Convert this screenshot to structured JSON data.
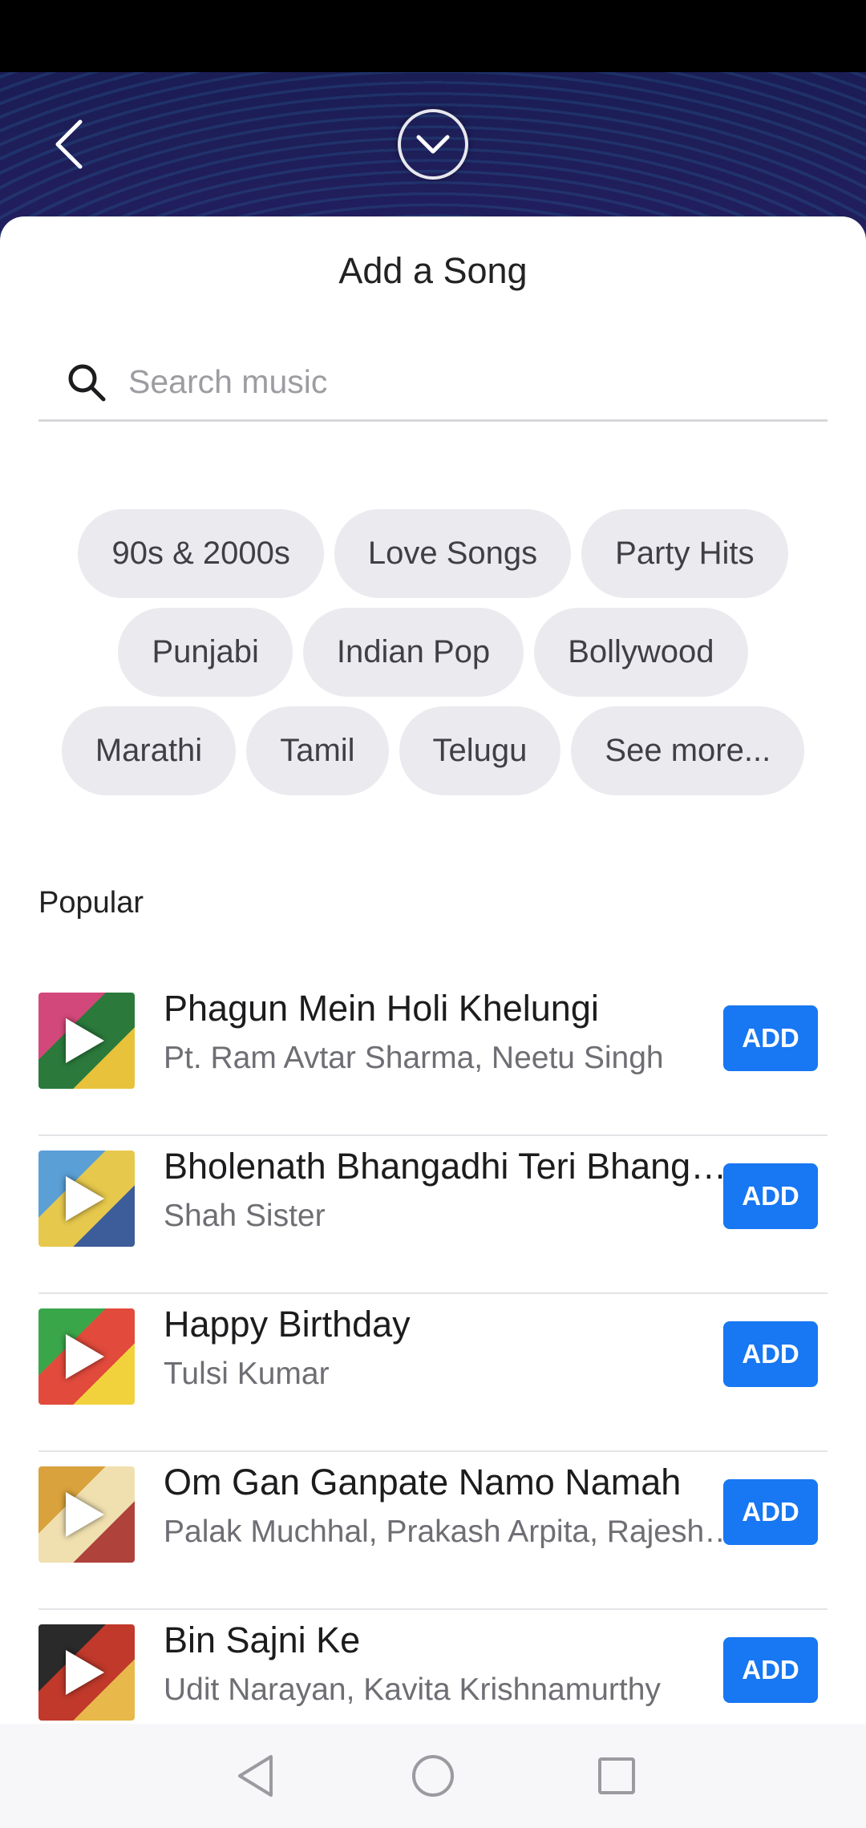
{
  "sheet": {
    "title": "Add a Song"
  },
  "search": {
    "placeholder": "Search music"
  },
  "genres": [
    [
      "90s & 2000s",
      "Love Songs",
      "Party Hits"
    ],
    [
      "Punjabi",
      "Indian Pop",
      "Bollywood"
    ],
    [
      "Marathi",
      "Tamil",
      "Telugu",
      "See more..."
    ]
  ],
  "popular": {
    "label": "Popular",
    "add_label": "ADD",
    "songs": [
      {
        "title": "Phagun Mein Holi Khelungi",
        "artist": "Pt. Ram Avtar Sharma, Neetu Singh",
        "art_colors": [
          "#d3487a",
          "#2b7a3c",
          "#e8c23a"
        ]
      },
      {
        "title": "Bholenath Bhangadhi Teri Bhangadhi Teri",
        "artist": "Shah Sister",
        "art_colors": [
          "#5a9fd6",
          "#e6c84c",
          "#3c5c9a"
        ]
      },
      {
        "title": "Happy Birthday",
        "artist": "Tulsi Kumar",
        "art_colors": [
          "#3aa64a",
          "#e24a3c",
          "#f2d23c"
        ]
      },
      {
        "title": "Om Gan Ganpate Namo Namah",
        "artist": "Palak Muchhal, Prakash Arpita, Rajesh Kumar",
        "art_colors": [
          "#d9a23c",
          "#f0e0b0",
          "#b0423c"
        ]
      },
      {
        "title": "Bin Sajni Ke",
        "artist": "Udit Narayan, Kavita Krishnamurthy",
        "art_colors": [
          "#2a2a2a",
          "#c0392b",
          "#e8b84a"
        ]
      }
    ]
  },
  "theme": {
    "accent": "#1877f2",
    "header_bg": "#1b1d55"
  }
}
